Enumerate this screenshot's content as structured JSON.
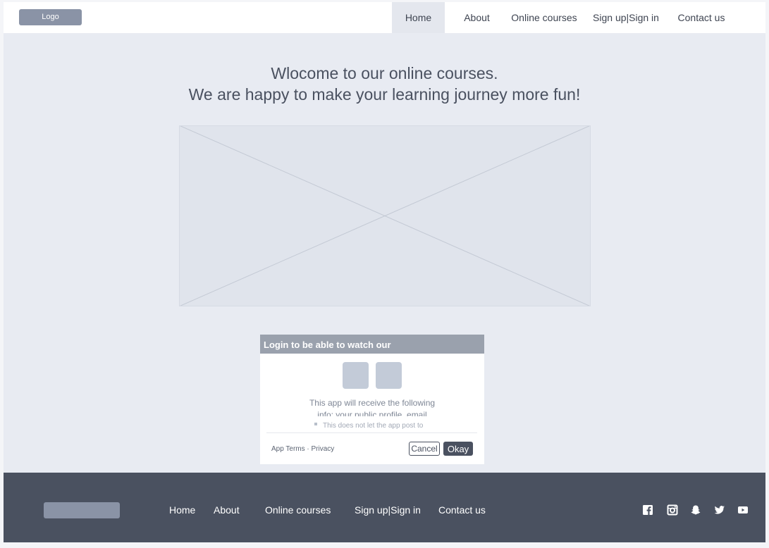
{
  "header": {
    "logo_label": "Logo",
    "nav": [
      "Home",
      "About",
      "Online courses",
      "Sign up|Sign in",
      "Contact us"
    ],
    "active_nav": "Home"
  },
  "hero": {
    "title_line1": "Wlocome to our online courses.",
    "title_line2": "We are happy to make your learning journey more fun!"
  },
  "dialog": {
    "title": "Login to be able to watch our",
    "receive_text": "This app will receive the following",
    "info_text": "info: your public profile, email",
    "notice_text": "This does not let the app post to",
    "links": "App Terms · Privacy",
    "cancel_label": "Cancel",
    "okay_label": "Okay"
  },
  "footer": {
    "nav": [
      "Home",
      "About",
      "Online courses",
      "Sign up|Sign in",
      "Contact us"
    ],
    "social": [
      "facebook-icon",
      "instagram-icon",
      "snapchat-icon",
      "twitter-icon",
      "youtube-icon"
    ]
  },
  "colors": {
    "page_bg": "#e8ebf2",
    "header_bg": "#ffffff",
    "footer_bg": "#4a5160",
    "placeholder_bg": "#e0e4ec",
    "dialog_header_bg": "#9aa1ad",
    "accent": "#8a93a6"
  }
}
